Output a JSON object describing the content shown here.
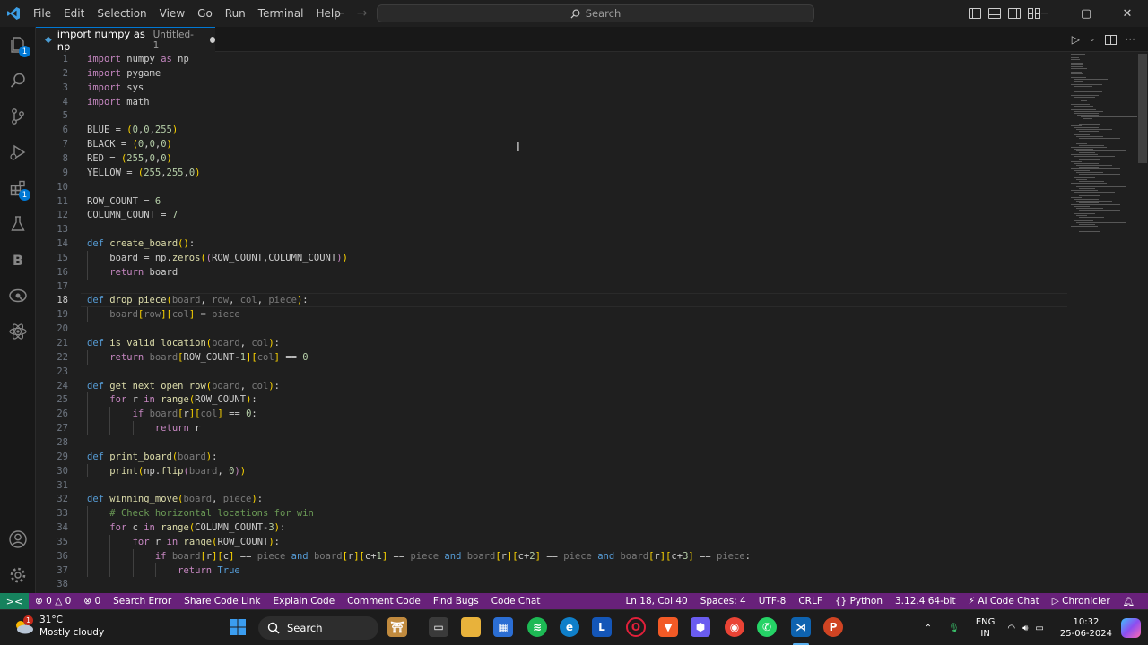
{
  "menu": [
    "File",
    "Edit",
    "Selection",
    "View",
    "Go",
    "Run",
    "Terminal",
    "Help"
  ],
  "search": {
    "label": "Search"
  },
  "tab": {
    "title": "import numpy as np",
    "subtitle": "Untitled-1"
  },
  "code": {
    "lines": [
      {
        "n": "1",
        "html": "<span class=\"ctl\">import</span> numpy <span class=\"ctl\">as</span> np"
      },
      {
        "n": "2",
        "html": "<span class=\"ctl\">import</span> pygame"
      },
      {
        "n": "3",
        "html": "<span class=\"ctl\">import</span> sys"
      },
      {
        "n": "4",
        "html": "<span class=\"ctl\">import</span> math"
      },
      {
        "n": "5",
        "html": ""
      },
      {
        "n": "6",
        "html": "BLUE = <span class=\"pu\">(</span><span class=\"num\">0</span>,<span class=\"num\">0</span>,<span class=\"num\">255</span><span class=\"pu\">)</span>"
      },
      {
        "n": "7",
        "html": "BLACK = <span class=\"pu\">(</span><span class=\"num\">0</span>,<span class=\"num\">0</span>,<span class=\"num\">0</span><span class=\"pu\">)</span>"
      },
      {
        "n": "8",
        "html": "RED = <span class=\"pu\">(</span><span class=\"num\">255</span>,<span class=\"num\">0</span>,<span class=\"num\">0</span><span class=\"pu\">)</span>"
      },
      {
        "n": "9",
        "html": "YELLOW = <span class=\"pu\">(</span><span class=\"num\">255</span>,<span class=\"num\">255</span>,<span class=\"num\">0</span><span class=\"pu\">)</span>"
      },
      {
        "n": "10",
        "html": ""
      },
      {
        "n": "11",
        "html": "ROW_COUNT = <span class=\"num\">6</span>"
      },
      {
        "n": "12",
        "html": "COLUMN_COUNT = <span class=\"num\">7</span>"
      },
      {
        "n": "13",
        "html": ""
      },
      {
        "n": "14",
        "html": "<span class=\"kw\">def</span> <span class=\"fn\">create_board</span><span class=\"pu\">()</span>:"
      },
      {
        "n": "15",
        "html": "    board = np.<span class=\"fn\">zeros</span><span class=\"pu\">(</span><span class=\"ctl\">(</span>ROW_COUNT,COLUMN_COUNT<span class=\"ctl\">)</span><span class=\"pu\">)</span>"
      },
      {
        "n": "16",
        "html": "    <span class=\"ctl\">return</span> board"
      },
      {
        "n": "17",
        "html": ""
      },
      {
        "n": "18",
        "html": "<span class=\"kw\">def</span> <span class=\"fn\">drop_piece</span><span class=\"pu\">(</span><span class=\"dim\">board</span>, <span class=\"dim\">row</span>, <span class=\"dim\">col</span>, <span class=\"dim\">piece</span><span class=\"pu\">)</span>:"
      },
      {
        "n": "19",
        "html": "    <span class=\"dim\">board</span><span class=\"pu\">[</span><span class=\"dim\">row</span><span class=\"pu\">][</span><span class=\"dim\">col</span><span class=\"pu\">]</span> <span class=\"dim\">= piece</span>"
      },
      {
        "n": "20",
        "html": ""
      },
      {
        "n": "21",
        "html": "<span class=\"kw\">def</span> <span class=\"fn\">is_valid_location</span><span class=\"pu\">(</span><span class=\"dim\">board</span>, <span class=\"dim\">col</span><span class=\"pu\">)</span>:"
      },
      {
        "n": "22",
        "html": "    <span class=\"ctl\">return</span> <span class=\"dim\">board</span><span class=\"pu\">[</span>ROW_COUNT-<span class=\"num\">1</span><span class=\"pu\">][</span><span class=\"dim\">col</span><span class=\"pu\">]</span> == <span class=\"num\">0</span>"
      },
      {
        "n": "23",
        "html": ""
      },
      {
        "n": "24",
        "html": "<span class=\"kw\">def</span> <span class=\"fn\">get_next_open_row</span><span class=\"pu\">(</span><span class=\"dim\">board</span>, <span class=\"dim\">col</span><span class=\"pu\">)</span>:"
      },
      {
        "n": "25",
        "html": "    <span class=\"ctl\">for</span> r <span class=\"ctl\">in</span> <span class=\"fn\">range</span><span class=\"pu\">(</span>ROW_COUNT<span class=\"pu\">)</span>:"
      },
      {
        "n": "26",
        "html": "        <span class=\"ctl\">if</span> <span class=\"dim\">board</span><span class=\"pu\">[</span>r<span class=\"pu\">][</span><span class=\"dim\">col</span><span class=\"pu\">]</span> == <span class=\"num\">0</span>:"
      },
      {
        "n": "27",
        "html": "            <span class=\"ctl\">return</span> r"
      },
      {
        "n": "28",
        "html": ""
      },
      {
        "n": "29",
        "html": "<span class=\"kw\">def</span> <span class=\"fn\">print_board</span><span class=\"pu\">(</span><span class=\"dim\">board</span><span class=\"pu\">)</span>:"
      },
      {
        "n": "30",
        "html": "    <span class=\"fn\">print</span><span class=\"pu\">(</span>np.<span class=\"fn\">flip</span><span class=\"ctl\">(</span><span class=\"dim\">board</span>, <span class=\"num\">0</span><span class=\"ctl\">)</span><span class=\"pu\">)</span>"
      },
      {
        "n": "31",
        "html": ""
      },
      {
        "n": "32",
        "html": "<span class=\"kw\">def</span> <span class=\"fn\">winning_move</span><span class=\"pu\">(</span><span class=\"dim\">board</span>, <span class=\"dim\">piece</span><span class=\"pu\">)</span>:"
      },
      {
        "n": "33",
        "html": "    <span class=\"cm\"># Check horizontal locations for win</span>"
      },
      {
        "n": "34",
        "html": "    <span class=\"ctl\">for</span> c <span class=\"ctl\">in</span> <span class=\"fn\">range</span><span class=\"pu\">(</span>COLUMN_COUNT-<span class=\"num\">3</span><span class=\"pu\">)</span>:"
      },
      {
        "n": "35",
        "html": "        <span class=\"ctl\">for</span> r <span class=\"ctl\">in</span> <span class=\"fn\">range</span><span class=\"pu\">(</span>ROW_COUNT<span class=\"pu\">)</span>:"
      },
      {
        "n": "36",
        "html": "            <span class=\"ctl\">if</span> <span class=\"dim\">board</span><span class=\"pu\">[</span>r<span class=\"pu\">][</span>c<span class=\"pu\">]</span> == <span class=\"dim\">piece</span> <span class=\"kw\">and</span> <span class=\"dim\">board</span><span class=\"pu\">[</span>r<span class=\"pu\">][</span>c+<span class=\"num\">1</span><span class=\"pu\">]</span> == <span class=\"dim\">piece</span> <span class=\"kw\">and</span> <span class=\"dim\">board</span><span class=\"pu\">[</span>r<span class=\"pu\">][</span>c+<span class=\"num\">2</span><span class=\"pu\">]</span> == <span class=\"dim\">piece</span> <span class=\"kw\">and</span> <span class=\"dim\">board</span><span class=\"pu\">[</span>r<span class=\"pu\">][</span>c+<span class=\"num\">3</span><span class=\"pu\">]</span> == <span class=\"dim\">piece</span>:"
      },
      {
        "n": "37",
        "html": "                <span class=\"ctl\">return</span> <span class=\"kw\">True</span>"
      },
      {
        "n": "38",
        "html": ""
      }
    ],
    "current_line": "18"
  },
  "status": {
    "errors": "0",
    "warnings": "0",
    "ports": "0",
    "left_items": [
      "Search Error",
      "Share Code Link",
      "Explain Code",
      "Comment Code",
      "Find Bugs",
      "Code Chat"
    ],
    "cursor_pos": "Ln 18, Col 40",
    "spaces": "Spaces: 4",
    "encoding": "UTF-8",
    "eol": "CRLF",
    "language": "Python",
    "interpreter": "3.12.4 64-bit",
    "ai_chat": "AI Code Chat",
    "chronicler": "Chronicler"
  },
  "taskbar": {
    "temp": "31°C",
    "weather": "Mostly cloudy",
    "weather_badge": "1",
    "search": "Search",
    "lang1": "ENG",
    "lang2": "IN",
    "time": "10:32",
    "date": "25-06-2024"
  },
  "badges": {
    "explorer": "1",
    "extensions": "1"
  },
  "colors": {
    "statusbar": "#68217a",
    "accent": "#0078d4",
    "remote": "#16825d"
  }
}
